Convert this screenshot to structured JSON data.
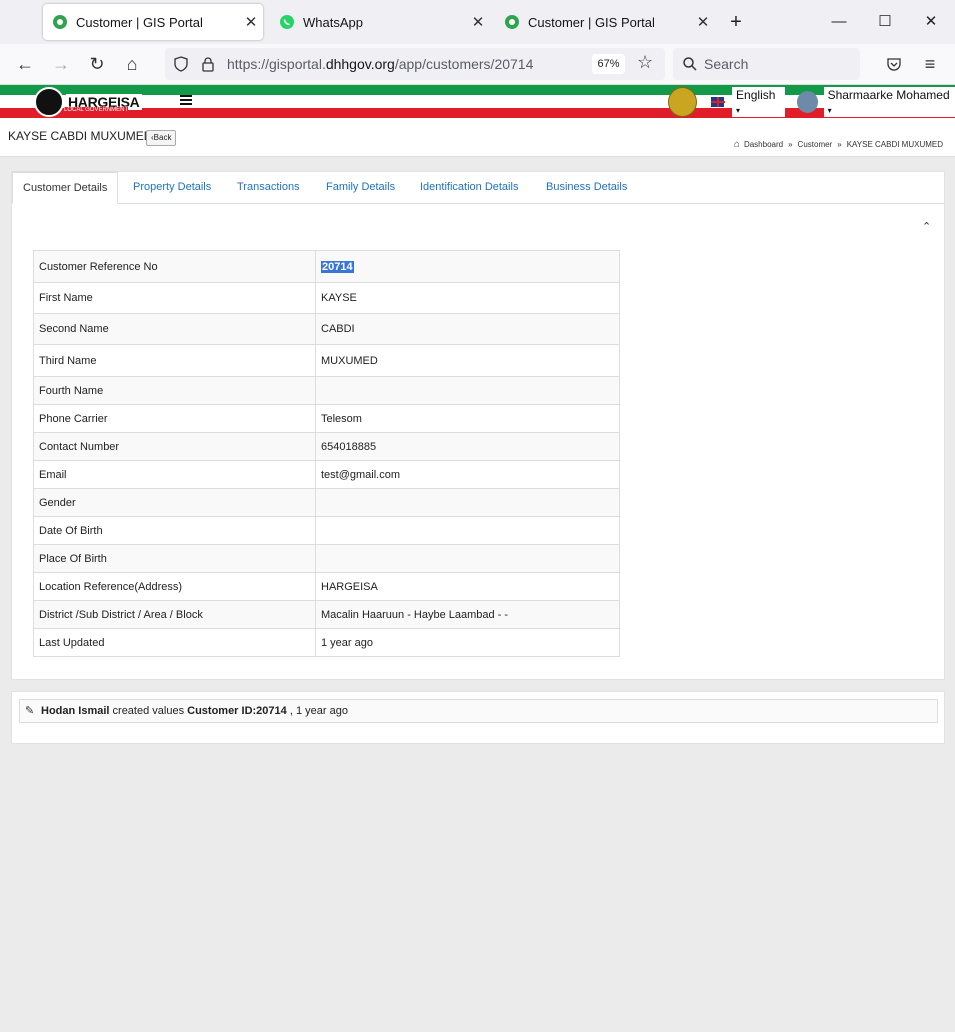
{
  "browser": {
    "tabs": [
      {
        "title": "Customer | GIS Portal",
        "active": true
      },
      {
        "title": "WhatsApp",
        "active": false
      },
      {
        "title": "Customer | GIS Portal",
        "active": false
      }
    ],
    "url_prefix": "https://gisportal.",
    "url_domain": "dhhgov.org",
    "url_path": "/app/customers/20714",
    "zoom": "67%",
    "search_placeholder": "Search"
  },
  "header": {
    "brand": "HARGEISA",
    "brand_sub": "LOCAL GOVERNMENT",
    "language": "English",
    "user": "Sharmaarke Mohamed"
  },
  "page": {
    "title": "KAYSE CABDI MUXUMED",
    "back_label": "Back",
    "breadcrumb": [
      "Dashboard",
      "Customer",
      "KAYSE CABDI MUXUMED"
    ]
  },
  "tabs": [
    "Customer Details",
    "Property Details",
    "Transactions",
    "Family Details",
    "Identification Details",
    "Business Details"
  ],
  "details": [
    {
      "label": "Customer Reference No",
      "value": "20714"
    },
    {
      "label": "First Name",
      "value": "KAYSE"
    },
    {
      "label": "Second Name",
      "value": "CABDI"
    },
    {
      "label": "Third Name",
      "value": "MUXUMED"
    },
    {
      "label": "Fourth Name",
      "value": ""
    },
    {
      "label": "Phone Carrier",
      "value": "Telesom"
    },
    {
      "label": "Contact Number",
      "value": "654018885"
    },
    {
      "label": "Email",
      "value": "test@gmail.com"
    },
    {
      "label": "Gender",
      "value": ""
    },
    {
      "label": "Date Of Birth",
      "value": ""
    },
    {
      "label": "Place Of Birth",
      "value": ""
    },
    {
      "label": "Location Reference(Address)",
      "value": "HARGEISA"
    },
    {
      "label": "District /Sub District / Area / Block",
      "value": "Macalin Haaruun - Haybe Laambad - -"
    },
    {
      "label": "Last Updated",
      "value": "1 year ago"
    }
  ],
  "activity": {
    "user": "Hodan Ismail",
    "action": " created values ",
    "subject": "Customer ID:20714",
    "time": " , 1 year ago"
  },
  "colors": {
    "green": "#139a48",
    "red": "#e21d2a",
    "link": "#1e73be",
    "highlight": "#3875d7"
  }
}
